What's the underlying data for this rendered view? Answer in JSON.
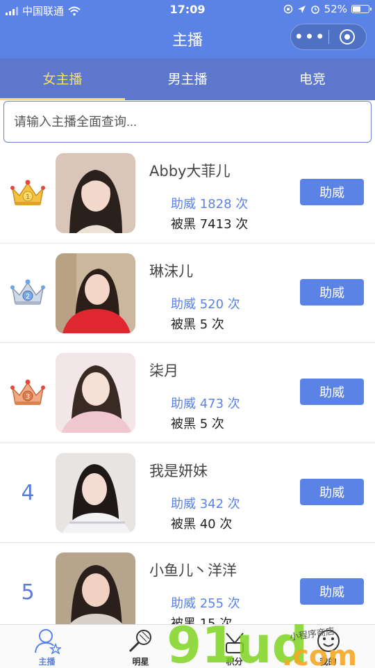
{
  "status_bar": {
    "carrier": "中国联通",
    "time": "17:09",
    "battery": "52%",
    "battery_level": 0.52
  },
  "nav": {
    "title": "主播",
    "more_icon": "more-dots-icon",
    "close_icon": "target-circle-icon"
  },
  "tabs": [
    {
      "label": "女主播",
      "active": true
    },
    {
      "label": "男主播",
      "active": false
    },
    {
      "label": "电竞",
      "active": false
    }
  ],
  "search": {
    "placeholder": "请输入主播全面查询..."
  },
  "list": [
    {
      "rank": "1",
      "rank_icon": "gold-crown-icon",
      "name": "Abby大菲儿",
      "support": "助威 1828 次",
      "blacked": "被黑 7413 次",
      "button": "助威"
    },
    {
      "rank": "2",
      "rank_icon": "silver-crown-icon",
      "name": "琳沫儿",
      "support": "助威 520 次",
      "blacked": "被黑 5 次",
      "button": "助威"
    },
    {
      "rank": "3",
      "rank_icon": "bronze-crown-icon",
      "name": "柒月",
      "support": "助威 473 次",
      "blacked": "被黑 5 次",
      "button": "助威"
    },
    {
      "rank": "4",
      "rank_icon": "",
      "name": "我是妍妹",
      "support": "助威 342 次",
      "blacked": "被黑 40 次",
      "button": "助威"
    },
    {
      "rank": "5",
      "rank_icon": "",
      "name": "小鱼儿丶洋洋",
      "support": "助威 255 次",
      "blacked": "被黑 15 次",
      "button": "助威"
    }
  ],
  "tabbar": [
    {
      "label": "主播",
      "icon": "anchor-person-icon",
      "active": true
    },
    {
      "label": "明星",
      "icon": "microphone-icon",
      "active": false
    },
    {
      "label": "积分",
      "icon": "points-icon",
      "active": false
    },
    {
      "label": "我的",
      "icon": "smiley-face-icon",
      "active": false
    }
  ],
  "watermark": {
    "main": "91ud",
    "suffix": ".com",
    "tagline": "小程序商店"
  },
  "colors": {
    "primary": "#5b83e6",
    "tabs_bg": "#5c77cb",
    "tab_active": "#f3e25a",
    "watermark_green": "#7ed321",
    "watermark_orange": "#f5a623"
  }
}
